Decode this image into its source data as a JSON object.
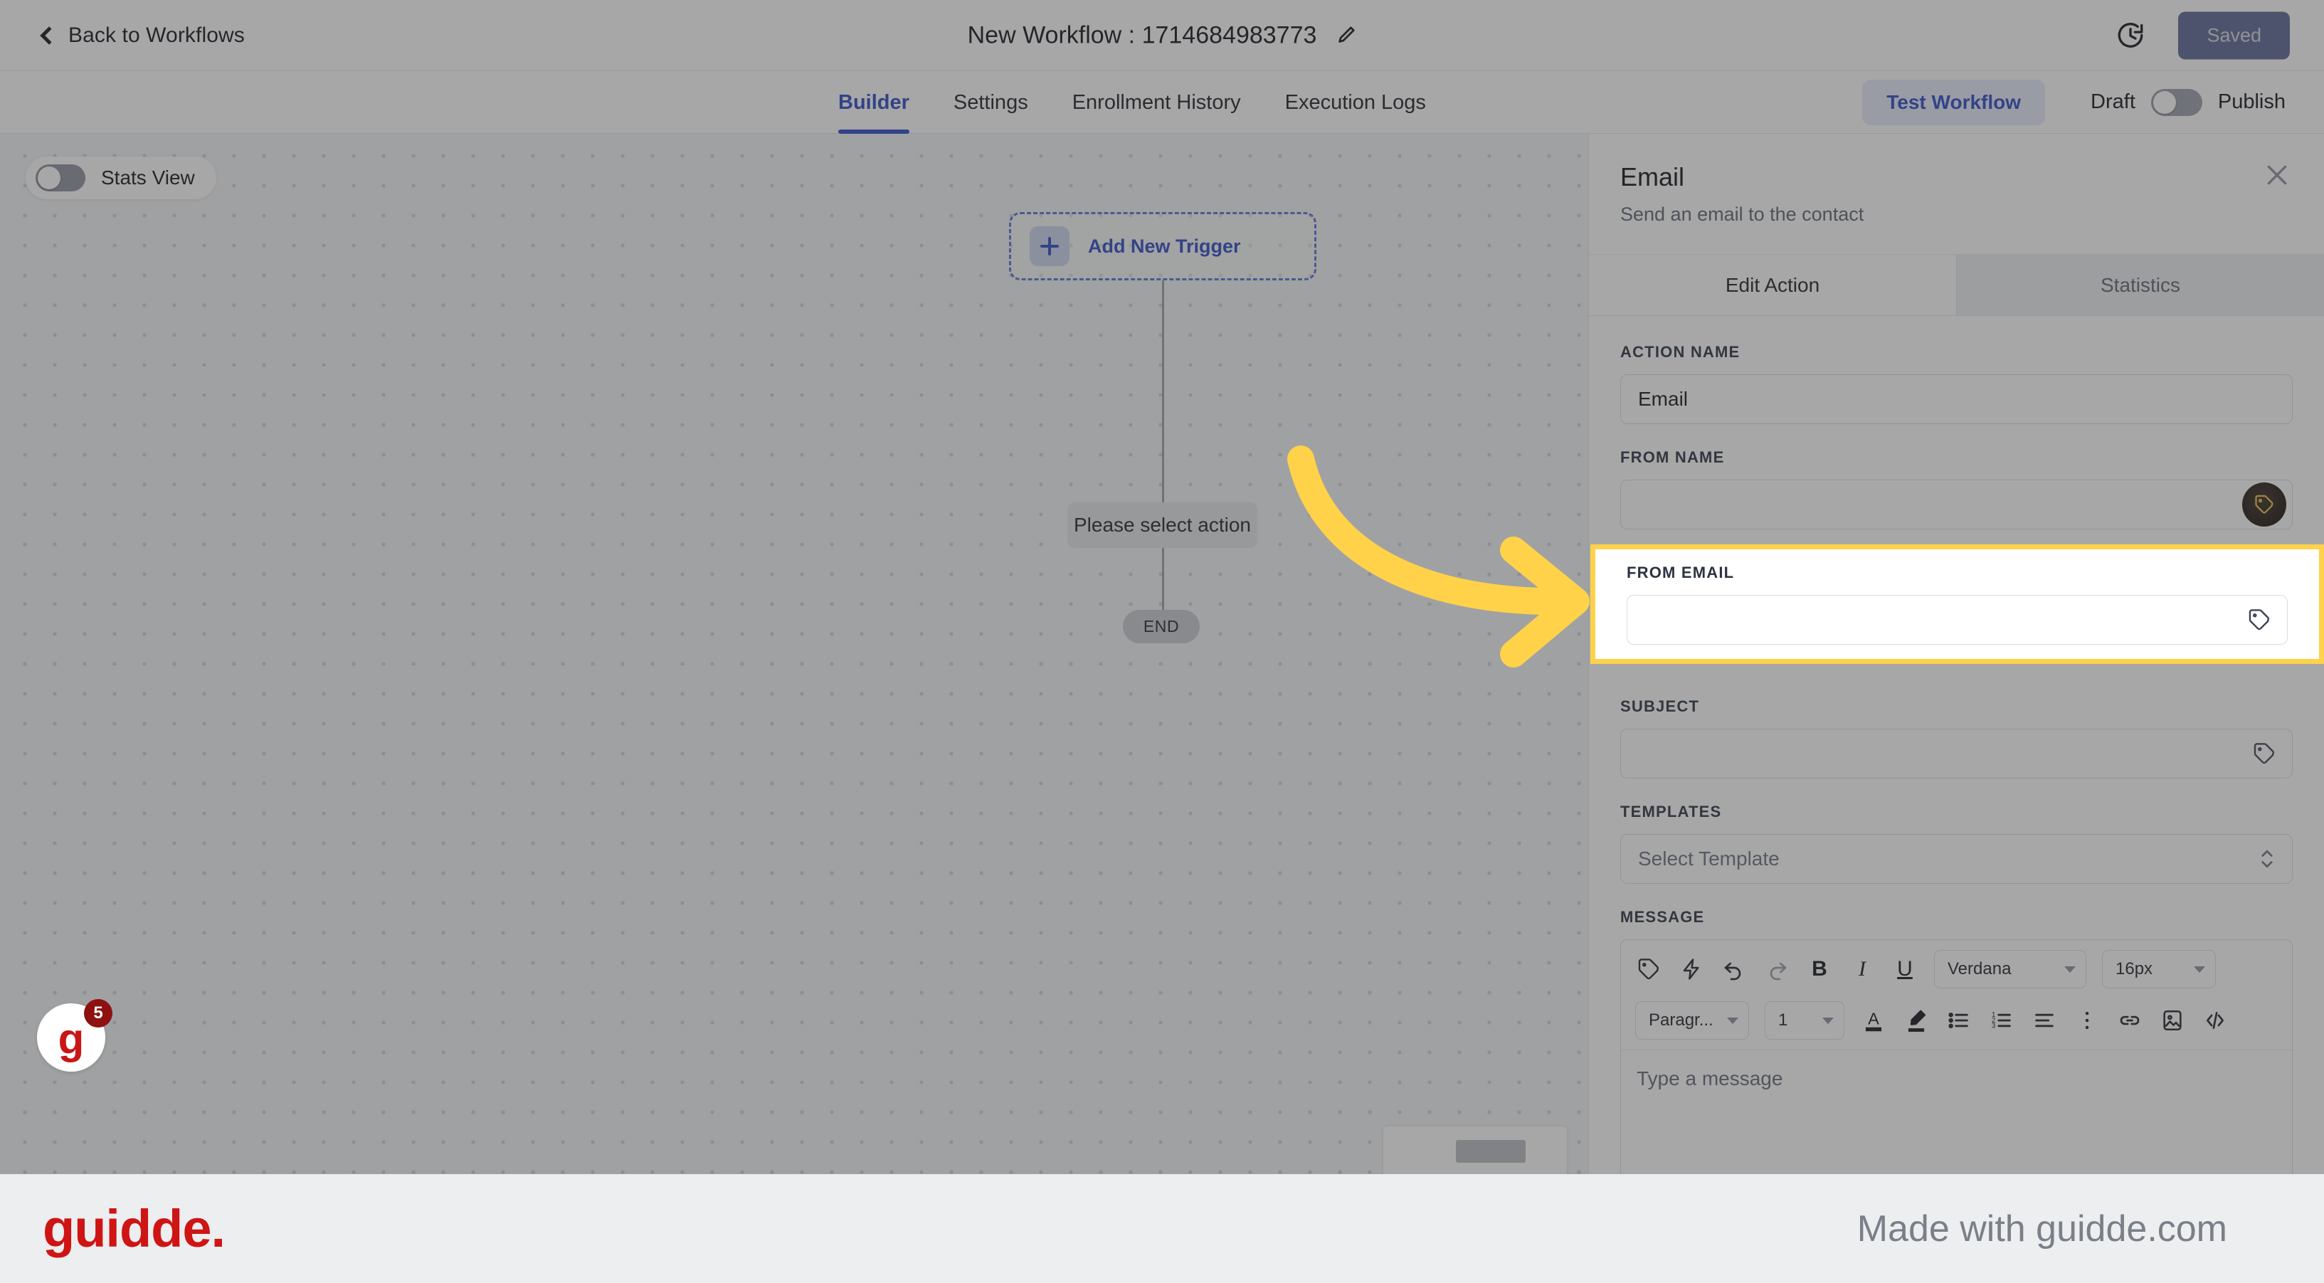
{
  "topbar": {
    "back_label": "Back to Workflows",
    "workflow_title": "New Workflow : 1714684983773",
    "edit_icon": "pencil-icon",
    "history_icon": "history-clock-icon",
    "saved_label": "Saved"
  },
  "tabs": {
    "items": [
      {
        "label": "Builder",
        "active": true
      },
      {
        "label": "Settings",
        "active": false
      },
      {
        "label": "Enrollment History",
        "active": false
      },
      {
        "label": "Execution Logs",
        "active": false
      }
    ],
    "test_workflow_label": "Test Workflow",
    "draft_label": "Draft",
    "publish_label": "Publish"
  },
  "canvas": {
    "stats_view_label": "Stats View",
    "add_new_trigger_label": "Add New Trigger",
    "select_action_label": "Please select action",
    "end_label": "END"
  },
  "panel": {
    "title": "Email",
    "subtitle": "Send an email to the contact",
    "close_icon": "close-x-icon",
    "tabs": [
      {
        "label": "Edit Action",
        "active": true
      },
      {
        "label": "Statistics",
        "active": false
      }
    ],
    "fields": {
      "action_name": {
        "label": "ACTION NAME",
        "value": "Email",
        "placeholder": ""
      },
      "from_name": {
        "label": "FROM NAME",
        "value": "",
        "placeholder": ""
      },
      "from_email": {
        "label": "FROM EMAIL",
        "value": "",
        "placeholder": ""
      },
      "subject": {
        "label": "SUBJECT",
        "value": "",
        "placeholder": ""
      },
      "templates": {
        "label": "TEMPLATES",
        "placeholder": "Select Template"
      },
      "message": {
        "label": "MESSAGE",
        "placeholder": "Type a message"
      }
    },
    "editor_toolbar": {
      "row1": [
        {
          "name": "tag-icon",
          "label": ""
        },
        {
          "name": "lightning-icon",
          "label": ""
        },
        {
          "name": "undo-icon",
          "label": ""
        },
        {
          "name": "redo-icon",
          "label": ""
        },
        {
          "name": "bold-icon",
          "label": "B"
        },
        {
          "name": "italic-icon",
          "label": "I"
        },
        {
          "name": "underline-icon",
          "label": "U"
        }
      ],
      "font_family": "Verdana",
      "font_size": "16px",
      "paragraph_style": "Paragr...",
      "line_height": "1",
      "row2": [
        {
          "name": "text-color-icon",
          "label": "A"
        },
        {
          "name": "highlight-color-icon",
          "label": ""
        },
        {
          "name": "bulleted-list-icon",
          "label": ""
        },
        {
          "name": "numbered-list-icon",
          "label": ""
        },
        {
          "name": "align-icon",
          "label": ""
        },
        {
          "name": "more-options-icon",
          "label": ""
        },
        {
          "name": "link-icon",
          "label": ""
        },
        {
          "name": "image-icon",
          "label": ""
        },
        {
          "name": "code-icon",
          "label": ""
        }
      ]
    }
  },
  "footer": {
    "logo_text": "guidde.",
    "made_with": "Made with guidde.com",
    "badge_count": "5",
    "badge_letter": "g"
  },
  "colors": {
    "accent_blue": "#2d49c6",
    "highlight_yellow": "#ffd24a",
    "arrow_yellow": "#ffd24a",
    "brand_red": "#cf1414",
    "saved_button": "#5b6794"
  }
}
